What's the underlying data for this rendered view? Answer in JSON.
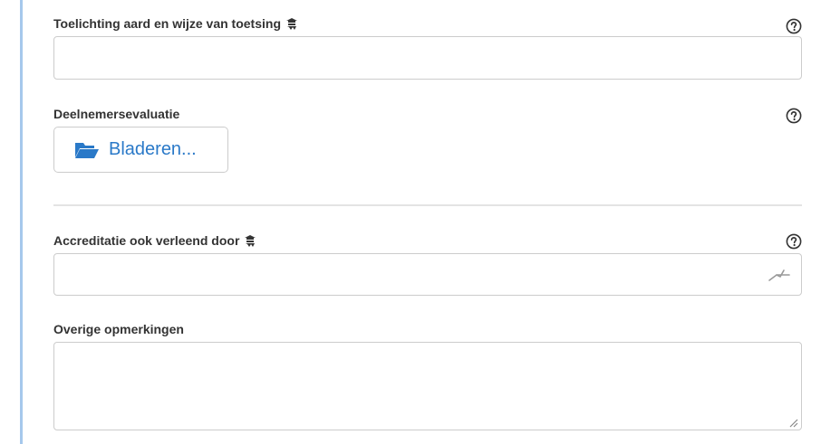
{
  "form": {
    "fields": [
      {
        "label": "Toelichting aard en wijze van toetsing",
        "value": "",
        "has_language_icon": true,
        "has_help": true
      },
      {
        "label": "Deelnemersevaluatie",
        "button_label": "Bladeren...",
        "has_help": true
      },
      {
        "label": "Accreditatie ook verleend door",
        "value": "",
        "has_language_icon": true,
        "has_help": true
      },
      {
        "label": "Overige opmerkingen",
        "value": ""
      }
    ]
  },
  "icons": {
    "help": "question-circle-icon",
    "language": "translate-icon",
    "folder": "folder-open-icon",
    "autocomplete": "autocomplete-icon",
    "resize": "resize-handle-icon"
  },
  "colors": {
    "accent": "#2a79c8",
    "left_rule": "#a6c8ec",
    "border": "#cccccc",
    "label": "#333333"
  }
}
